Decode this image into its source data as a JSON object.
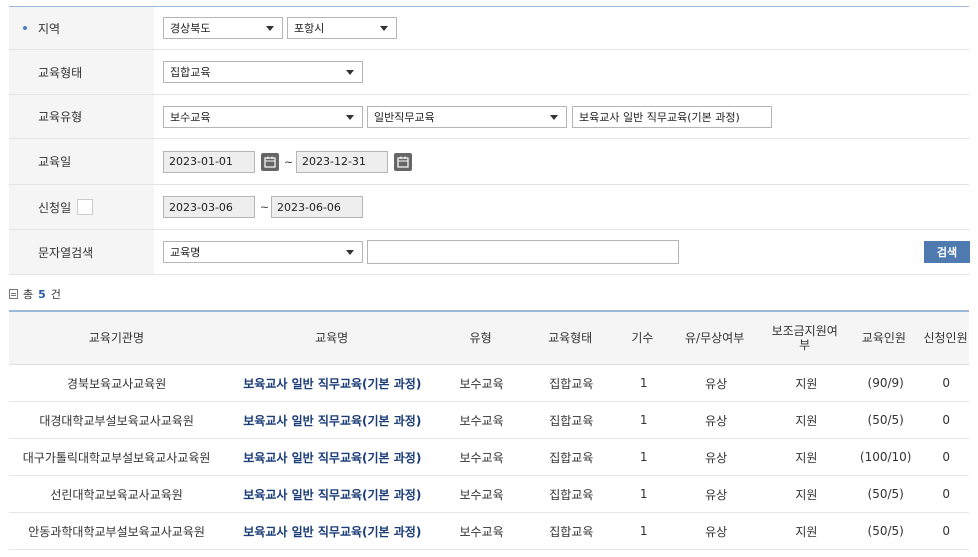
{
  "search_form": {
    "region": {
      "label": "지역",
      "province": "경상북도",
      "city": "포항시"
    },
    "edu_form": {
      "label": "교육형태",
      "value": "집합교육"
    },
    "edu_type": {
      "label": "교육유형",
      "category": "보수교육",
      "subcategory": "일반직무교육",
      "course": "보육교사 일반 직무교육(기본 과정)"
    },
    "edu_date": {
      "label": "교육일",
      "start": "2023-01-01",
      "end": "2023-12-31",
      "separator": "~"
    },
    "apply_date": {
      "label": "신청일",
      "start": "2023-03-06",
      "end": "2023-06-06",
      "separator": "~"
    },
    "keyword": {
      "label": "문자열검색",
      "field": "교육명",
      "value": "",
      "search_button": "검색"
    }
  },
  "results": {
    "total_prefix": "총",
    "total_count": "5",
    "total_suffix": "건",
    "columns": [
      "교육기관명",
      "교육명",
      "유형",
      "교육형태",
      "기수",
      "유/무상여부",
      "보조금지원여부",
      "교육인원",
      "신청인원"
    ],
    "rows": [
      {
        "institution": "경북보육교사교육원",
        "course": "보육교사 일반 직무교육(기본 과정)",
        "type": "보수교육",
        "form": "집합교육",
        "session": "1",
        "paid": "유상",
        "subsidy": "지원",
        "capacity": "(90/9)",
        "applicants": "0"
      },
      {
        "institution": "대경대학교부설보육교사교육원",
        "course": "보육교사 일반 직무교육(기본 과정)",
        "type": "보수교육",
        "form": "집합교육",
        "session": "1",
        "paid": "유상",
        "subsidy": "지원",
        "capacity": "(50/5)",
        "applicants": "0"
      },
      {
        "institution": "대구가톨릭대학교부설보육교사교육원",
        "course": "보육교사 일반 직무교육(기본 과정)",
        "type": "보수교육",
        "form": "집합교육",
        "session": "1",
        "paid": "유상",
        "subsidy": "지원",
        "capacity": "(100/10)",
        "applicants": "0"
      },
      {
        "institution": "선린대학교보육교사교육원",
        "course": "보육교사 일반 직무교육(기본 과정)",
        "type": "보수교육",
        "form": "집합교육",
        "session": "1",
        "paid": "유상",
        "subsidy": "지원",
        "capacity": "(50/5)",
        "applicants": "0"
      },
      {
        "institution": "안동과학대학교부설보육교사교육원",
        "course": "보육교사 일반 직무교육(기본 과정)",
        "type": "보수교육",
        "form": "집합교육",
        "session": "1",
        "paid": "유상",
        "subsidy": "지원",
        "capacity": "(50/5)",
        "applicants": "0"
      }
    ]
  },
  "icons": {
    "calendar": "calendar-icon",
    "dropdown": "chevron-down-icon",
    "document": "document-icon"
  },
  "colors": {
    "accent_border": "#9bbadb",
    "search_button": "#4f7ab0",
    "course_link": "#1a3c78",
    "count": "#2a5ea8"
  }
}
